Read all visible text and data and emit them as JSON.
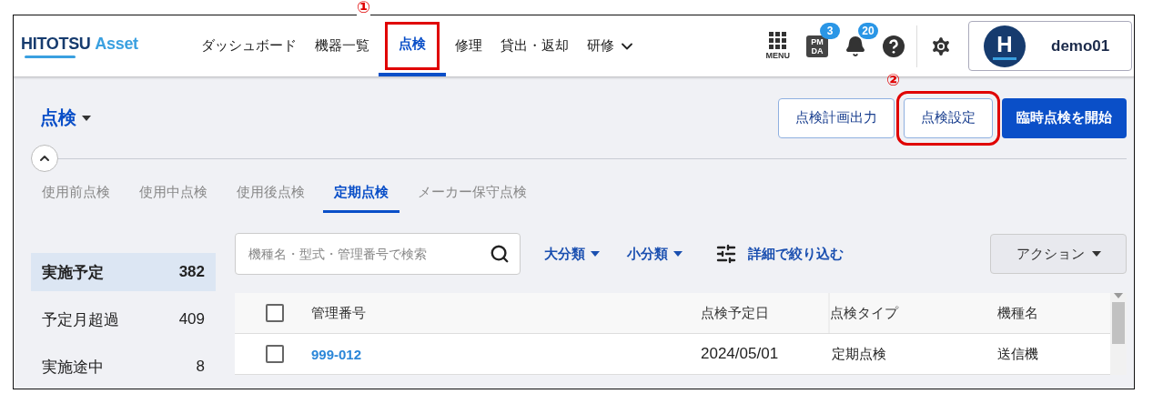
{
  "header": {
    "logo": {
      "primary": "HITOTSU",
      "secondary": "Asset"
    },
    "nav": [
      {
        "label": "ダッシュボード",
        "selected": false,
        "kind": "link"
      },
      {
        "label": "機器一覧",
        "selected": false,
        "kind": "link"
      },
      {
        "label": "点検",
        "selected": true,
        "kind": "link",
        "callout": "①"
      },
      {
        "label": "修理",
        "selected": false,
        "kind": "link"
      },
      {
        "label": "貸出・返却",
        "selected": false,
        "kind": "link"
      },
      {
        "label": "研修",
        "selected": false,
        "kind": "dropdown"
      }
    ],
    "menu_label": "MENU",
    "pmda_label": "PM DA",
    "pmda_badge": "3",
    "notification_badge": "20",
    "user": {
      "initial": "H",
      "name": "demo01"
    }
  },
  "page": {
    "title": "点検",
    "buttons": [
      {
        "label": "点検計画出力",
        "kind": "outline"
      },
      {
        "label": "点検設定",
        "kind": "outline",
        "callout": "②"
      },
      {
        "label": "臨時点検を開始",
        "kind": "primary"
      }
    ],
    "tabs": [
      {
        "label": "使用前点検",
        "selected": false
      },
      {
        "label": "使用中点検",
        "selected": false
      },
      {
        "label": "使用後点検",
        "selected": false
      },
      {
        "label": "定期点検",
        "selected": true
      },
      {
        "label": "メーカー保守点検",
        "selected": false
      }
    ]
  },
  "sidebar": {
    "items": [
      {
        "label": "実施予定",
        "count": "382",
        "selected": true
      },
      {
        "label": "予定月超過",
        "count": "409",
        "selected": false
      },
      {
        "label": "実施途中",
        "count": "8",
        "selected": false
      }
    ]
  },
  "toolbar": {
    "search": {
      "placeholder": "機種名・型式・管理番号で検索"
    },
    "filters": [
      "大分類",
      "小分類"
    ],
    "detail_filter": "詳細で絞り込む",
    "action": "アクション"
  },
  "table": {
    "columns": [
      "管理番号",
      "点検予定日",
      "点検タイプ",
      "機種名"
    ],
    "header_checked": false,
    "rows": [
      {
        "checked": false,
        "cells": [
          "999-012",
          "2024/05/01",
          "定期点検",
          "送信機"
        ]
      }
    ]
  }
}
